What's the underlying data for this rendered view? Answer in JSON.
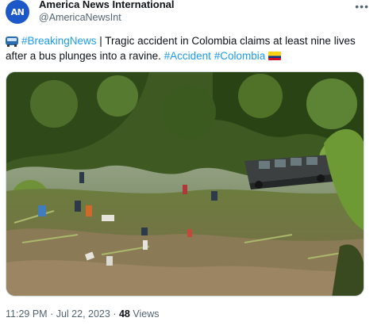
{
  "author": {
    "avatar_text_left": "AN",
    "avatar_text_right": "",
    "display_name": "America News International",
    "handle": "@AmericaNewsInt"
  },
  "icons": {
    "more": "more-icon",
    "verified": "none",
    "leading_emoji": "bus-icon",
    "trailing_emoji": "colombia-flag-icon"
  },
  "tweet": {
    "hashtag_breaking": "#BreakingNews",
    "body": " | Tragic accident in Colombia claims at least nine lives after a bus plunges into a ravine. ",
    "hashtag_accident": "#Accident",
    "hashtag_colombia": "#Colombia"
  },
  "media": {
    "kind": "photo",
    "subject": "overturned bus in a jungle ravine"
  },
  "meta": {
    "time": "11:29 PM",
    "date": "Jul 22, 2023",
    "separator": "·",
    "views_count": "48",
    "views_label": "Views"
  },
  "colors": {
    "link": "#1d9bf0",
    "text": "#0f1419",
    "secondary": "#536471",
    "avatar_bg": "#1d58c8"
  }
}
